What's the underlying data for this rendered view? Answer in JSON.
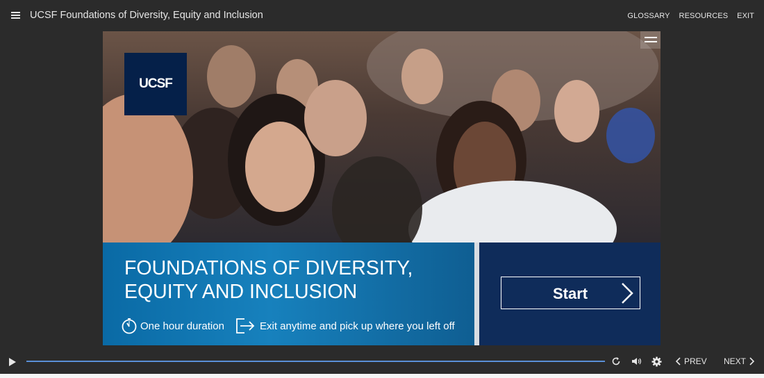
{
  "header": {
    "title": "UCSF Foundations of Diversity, Equity and Inclusion",
    "links": [
      "GLOSSARY",
      "RESOURCES",
      "EXIT"
    ]
  },
  "slide": {
    "logo_text": "UCSF",
    "course_title_line1": "FOUNDATIONS OF DIVERSITY,",
    "course_title_line2": "EQUITY AND INCLUSION",
    "info_duration": "One hour duration",
    "info_exit": "Exit anytime and pick up where you left off",
    "start_label": "Start"
  },
  "player": {
    "prev_label": "PREV",
    "next_label": "NEXT"
  },
  "colors": {
    "background": "#2b2b2b",
    "title_panel": "#1781bd",
    "start_panel": "#0f2c5a",
    "logo_bg": "#052049",
    "seek_bar": "#5a8fd6"
  },
  "icons": [
    "menu-icon",
    "stopwatch-icon",
    "exit-door-icon",
    "chevron-right-icon",
    "play-icon",
    "replay-icon",
    "volume-icon",
    "gear-icon",
    "chevron-left-icon"
  ]
}
